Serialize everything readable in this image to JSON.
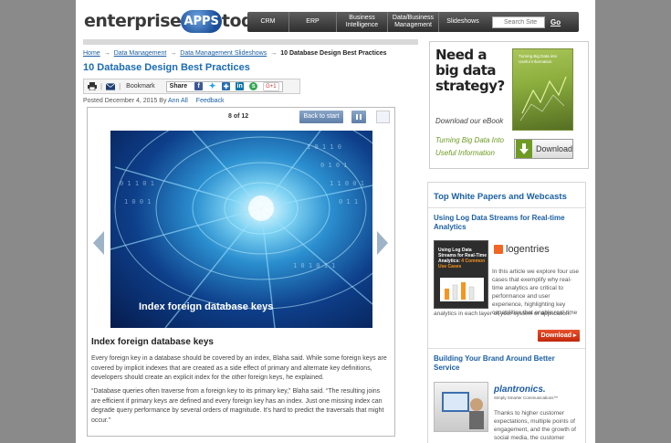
{
  "header": {
    "logo_part1": "enterprise",
    "logo_part2": "APPS",
    "logo_part3": "today",
    "nav": [
      {
        "label": "CRM"
      },
      {
        "label": "ERP"
      },
      {
        "label": "Business Intelligence"
      },
      {
        "label": "Data/Business Management"
      },
      {
        "label": "Slideshows"
      }
    ],
    "search_placeholder": "Search Site",
    "search_go": "Go"
  },
  "breadcrumb": {
    "home": "Home",
    "level1": "Data Management",
    "level2": "Data Management Slideshows",
    "current": "10 Database Design Best Practices",
    "separator": "→"
  },
  "article": {
    "title": "10 Database Design Best Practices",
    "posted_prefix": "Posted December 4, 2015 By ",
    "author": "Ann All",
    "feedback": "Feedback"
  },
  "toolbar": {
    "bookmark": "Bookmark",
    "share": "Share",
    "gplus": "G+1",
    "sep": "|"
  },
  "slideshow": {
    "counter": "8 of 12",
    "back_to_start": "Back to start",
    "caption": "Index foreign database keys",
    "heading": "Index foreign database keys",
    "paragraph1": "Every foreign key in a database should be covered by an index, Blaha said. While some foreign keys are covered by implicit indexes that are created as a side effect of primary and alternate key definitions, developers should create an explicit index for the other foreign keys, he explained.",
    "paragraph2": "“Database queries often traverse from a foreign key to its primary key,” Blaha said. “The resulting joins are efficient if primary keys are defined and every foreign key has an index. Just one missing index can degrade query performance by several orders of magnitude. It's hard to predict the traversals that might occur.”"
  },
  "ad": {
    "headline_line1": "Need a",
    "headline_line2": "big data",
    "headline_line3": "strategy?",
    "download_ebook": "Download our eBook",
    "subline": "Turning Big Data Into Useful Information",
    "book_title": "Turning Big Data into Useful Information",
    "download_button": "Download"
  },
  "white_papers": {
    "heading": "Top White Papers and Webcasts",
    "items": [
      {
        "title": "Using Log Data Streams for Real-time Analytics",
        "cover_title": "Using Log Data Streams for Real-Time Analytics:",
        "cover_sub": "4 Common Use Cases",
        "brand": "logentries",
        "description": "In this article we explore four use cases that exemplify why real-time analytics are critical to performance and user experience, highlighting key capabilities that enable real-time",
        "description_cont": "analytics in each layer of your system or application.",
        "download": "Download ▸"
      },
      {
        "title": "Building Your Brand Around Better Service",
        "brand": "plantronics.",
        "tagline": "Simply Smarter Communications™",
        "description": "Thanks to higher customer expectations, multiple points of engagement, and the growth of social media, the customer"
      }
    ]
  },
  "colors": {
    "link_blue": "#1a5fa3",
    "title_blue": "#1a6cb4",
    "ad_green": "#6c9a1f",
    "download_red": "#c1280d"
  }
}
